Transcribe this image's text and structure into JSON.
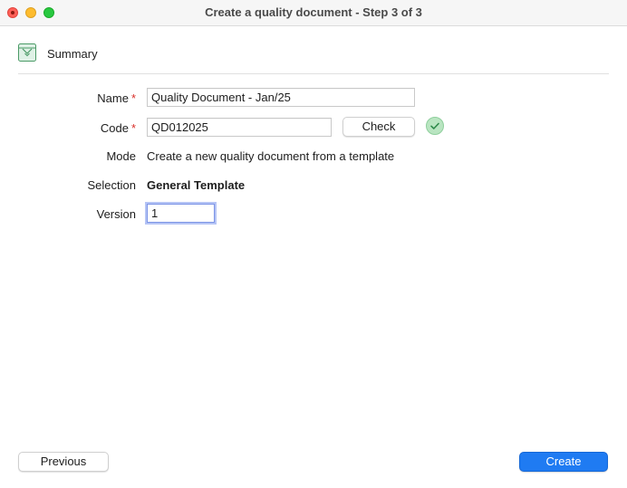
{
  "window": {
    "title": "Create a quality document - Step 3 of 3"
  },
  "section": {
    "label": "Summary"
  },
  "form": {
    "name": {
      "label": "Name",
      "required": "*",
      "value": "Quality Document - Jan/25"
    },
    "code": {
      "label": "Code",
      "required": "*",
      "value": "QD012025",
      "check_label": "Check"
    },
    "mode": {
      "label": "Mode",
      "value": "Create a new quality document from a template"
    },
    "selection": {
      "label": "Selection",
      "value": "General Template"
    },
    "version": {
      "label": "Version",
      "value": "1"
    }
  },
  "footer": {
    "previous_label": "Previous",
    "create_label": "Create"
  },
  "icons": {
    "close": "close-icon",
    "minimize": "minimize-icon",
    "maximize": "maximize-icon",
    "summary": "summary-document-icon",
    "check_status": "checkmark-icon"
  },
  "colors": {
    "primary": "#1f7bf2",
    "required": "#d9312b",
    "success": "#b9e5c1",
    "focus": "#7b93e6"
  }
}
